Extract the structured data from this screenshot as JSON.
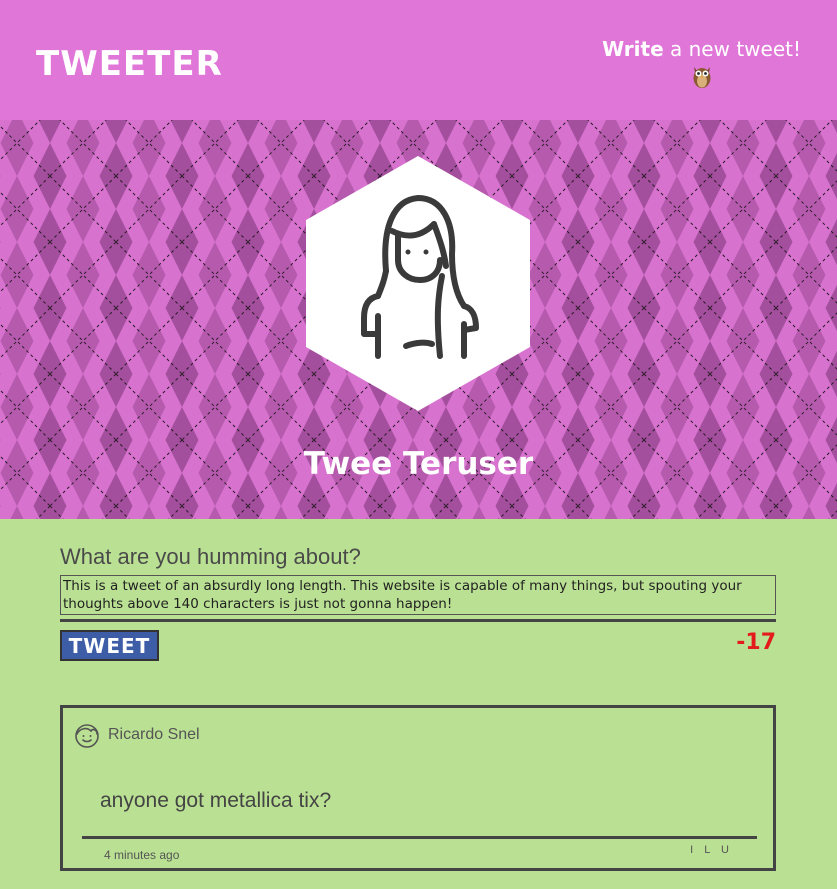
{
  "nav": {
    "logo": "TWEETER",
    "compose_bold": "Write",
    "compose_rest": " a new tweet!",
    "owl_icon": "owl-icon"
  },
  "header": {
    "username": "Twee Teruser",
    "avatar_icon": "woman-avatar-icon",
    "colors": {
      "primary": "#e076d8",
      "diamond_dark": "#a04e99",
      "diamond_mid": "#bf5fb8"
    }
  },
  "new_tweet": {
    "prompt": "What are you humming about?",
    "text": "This is a tweet of an absurdly long length. This website is capable of many things, but spouting your thoughts above 140 characters is just not gonna happen!",
    "button_label": "TWEET",
    "counter": "-17",
    "counter_color": "#e31b1b"
  },
  "tweets": [
    {
      "author": "Ricardo Snel",
      "avatar_icon": "boy-avatar-icon",
      "body": "anyone got metallica tix?",
      "time": "4 minutes ago",
      "actions": [
        "I",
        "L",
        "U"
      ]
    }
  ],
  "colors": {
    "page_bg": "#bae193",
    "button_bg": "#3d5da7",
    "border": "#444444"
  }
}
